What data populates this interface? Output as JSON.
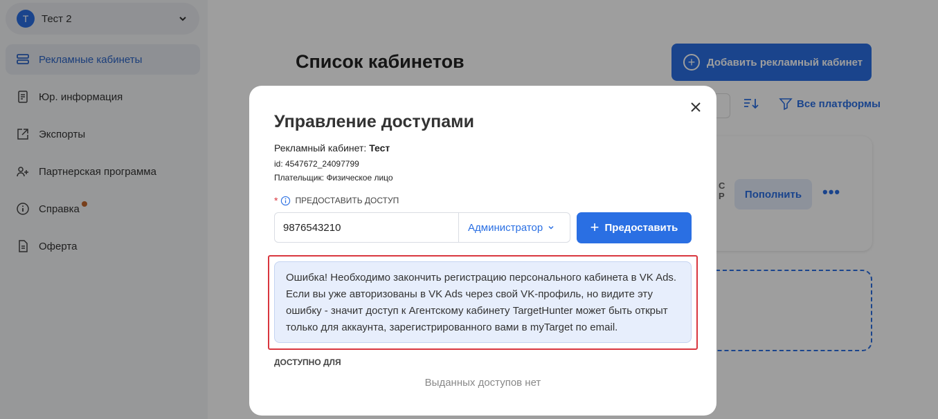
{
  "account": {
    "initial": "Т",
    "name": "Тест 2"
  },
  "sidebar": {
    "items": [
      {
        "label": "Рекламные кабинеты",
        "icon": "layers-icon",
        "active": true
      },
      {
        "label": "Юр. информация",
        "icon": "document-icon"
      },
      {
        "label": "Экспорты",
        "icon": "export-icon"
      },
      {
        "label": "Партнерская программа",
        "icon": "user-plus-icon"
      },
      {
        "label": "Справка",
        "icon": "info-icon",
        "badge": true
      },
      {
        "label": "Оферта",
        "icon": "file-icon"
      }
    ]
  },
  "main": {
    "title": "Список кабинетов",
    "add_button": "Добавить рекламный кабинет",
    "platforms_filter": "Все платформы",
    "card": {
      "partial_1": "С",
      "partial_2": "Р",
      "topup_button": "Пополнить",
      "more": "•••"
    }
  },
  "modal": {
    "title": "Управление доступами",
    "cabinet_label": "Рекламный кабинет:",
    "cabinet_value": "Тест",
    "id_line": "id: 4547672_24097799",
    "payer_label": "Плательщик:",
    "payer_value": "Физическое лицо",
    "grant_label": "Предоставить доступ",
    "grant_input_value": "9876543210",
    "role_value": "Администратор",
    "grant_button": "Предоставить",
    "error_text": "Ошибка! Необходимо закончить регистрацию персонального кабинета в VK Ads. Если вы уже авторизованы в VK Ads через свой VK-профиль, но видите эту ошибку - значит доступ к Агентскому кабинету TargetHunter может быть открыт только для аккаунта, зарегистрированного вами в myTarget по email.",
    "available_label": "Доступно для",
    "no_access_text": "Выданных доступов нет"
  },
  "colors": {
    "accent": "#2a6fe3",
    "error": "#d9363e",
    "error_bg": "#e7eefc"
  }
}
